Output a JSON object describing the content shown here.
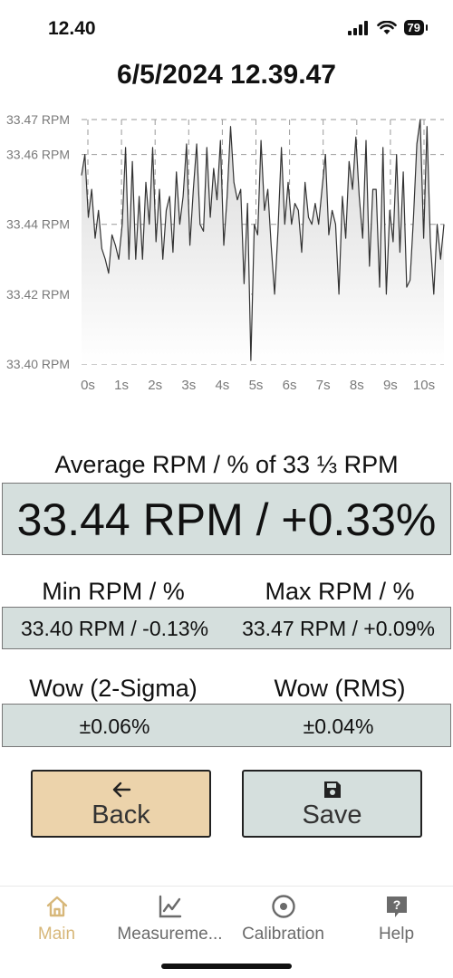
{
  "status": {
    "time": "12.40",
    "battery": "79"
  },
  "title": "6/5/2024 12.39.47",
  "chart_data": {
    "type": "line",
    "title": "",
    "xlabel": "",
    "ylabel": "",
    "x_ticks": [
      "0s",
      "1s",
      "2s",
      "3s",
      "4s",
      "5s",
      "6s",
      "7s",
      "8s",
      "9s",
      "10s"
    ],
    "y_ticks": [
      "33.40 RPM",
      "33.42 RPM",
      "33.44 RPM",
      "33.46 RPM",
      "33.47 RPM"
    ],
    "ylim": [
      33.4,
      33.47
    ],
    "xlim": [
      0,
      10.7
    ],
    "grid": true,
    "series": [
      {
        "x": [
          0,
          0.1,
          0.2,
          0.3,
          0.4,
          0.5,
          0.6,
          0.7,
          0.8,
          0.9,
          1.0,
          1.1,
          1.2,
          1.3,
          1.4,
          1.5,
          1.6,
          1.7,
          1.8,
          1.9,
          2.0,
          2.1,
          2.2,
          2.3,
          2.4,
          2.5,
          2.6,
          2.7,
          2.8,
          2.9,
          3.0,
          3.1,
          3.2,
          3.3,
          3.4,
          3.5,
          3.6,
          3.7,
          3.8,
          3.9,
          4.0,
          4.1,
          4.2,
          4.3,
          4.4,
          4.5,
          4.6,
          4.7,
          4.8,
          4.9,
          5.0,
          5.1,
          5.2,
          5.3,
          5.4,
          5.5,
          5.6,
          5.7,
          5.8,
          5.9,
          6.0,
          6.1,
          6.2,
          6.3,
          6.4,
          6.5,
          6.6,
          6.7,
          6.8,
          6.9,
          7.0,
          7.1,
          7.2,
          7.3,
          7.4,
          7.5,
          7.6,
          7.7,
          7.8,
          7.9,
          8.0,
          8.1,
          8.2,
          8.3,
          8.4,
          8.5,
          8.6,
          8.7,
          8.8,
          8.9,
          9.0,
          9.1,
          9.2,
          9.3,
          9.4,
          9.5,
          9.6,
          9.7,
          9.8,
          9.9,
          10.0,
          10.1,
          10.2,
          10.3,
          10.4,
          10.5,
          10.6,
          10.7
        ],
        "values": [
          33.454,
          33.46,
          33.442,
          33.45,
          33.436,
          33.444,
          33.433,
          33.43,
          33.426,
          33.437,
          33.434,
          33.43,
          33.44,
          33.462,
          33.43,
          33.458,
          33.43,
          33.448,
          33.43,
          33.452,
          33.44,
          33.462,
          33.435,
          33.45,
          33.43,
          33.444,
          33.448,
          33.432,
          33.455,
          33.44,
          33.448,
          33.463,
          33.434,
          33.45,
          33.463,
          33.44,
          33.438,
          33.462,
          33.442,
          33.456,
          33.447,
          33.464,
          33.434,
          33.448,
          33.468,
          33.452,
          33.447,
          33.45,
          33.423,
          33.446,
          33.401,
          33.44,
          33.437,
          33.464,
          33.444,
          33.45,
          33.434,
          33.42,
          33.438,
          33.462,
          33.44,
          33.452,
          33.44,
          33.446,
          33.444,
          33.432,
          33.452,
          33.442,
          33.44,
          33.446,
          33.44,
          33.45,
          33.46,
          33.437,
          33.444,
          33.44,
          33.42,
          33.448,
          33.436,
          33.458,
          33.45,
          33.465,
          33.448,
          33.436,
          33.464,
          33.428,
          33.45,
          33.45,
          33.422,
          33.462,
          33.42,
          33.444,
          33.435,
          33.46,
          33.432,
          33.455,
          33.422,
          33.424,
          33.442,
          33.463,
          33.47,
          33.436,
          33.468,
          33.435,
          33.42,
          33.44,
          33.43,
          33.44
        ],
        "color": "#333333"
      }
    ]
  },
  "average": {
    "label": "Average RPM / % of 33 ⅓ RPM",
    "value": "33.44 RPM / +0.33%"
  },
  "min": {
    "label": "Min RPM / %",
    "value": "33.40 RPM / -0.13%"
  },
  "max": {
    "label": "Max RPM / %",
    "value": "33.47 RPM / +0.09%"
  },
  "wow_2sigma": {
    "label": "Wow (2-Sigma)",
    "value": "±0.06%"
  },
  "wow_rms": {
    "label": "Wow (RMS)",
    "value": "±0.04%"
  },
  "buttons": {
    "back": "Back",
    "save": "Save"
  },
  "tabs": [
    {
      "label": "Main",
      "icon": "home-icon",
      "active": true
    },
    {
      "label": "Measureme...",
      "icon": "chart-icon",
      "active": false
    },
    {
      "label": "Calibration",
      "icon": "target-icon",
      "active": false
    },
    {
      "label": "Help",
      "icon": "help-icon",
      "active": false
    }
  ],
  "colors": {
    "accent": "#d7b779",
    "value_box": "#d5dfdd",
    "back_button": "#ecd3ab"
  }
}
